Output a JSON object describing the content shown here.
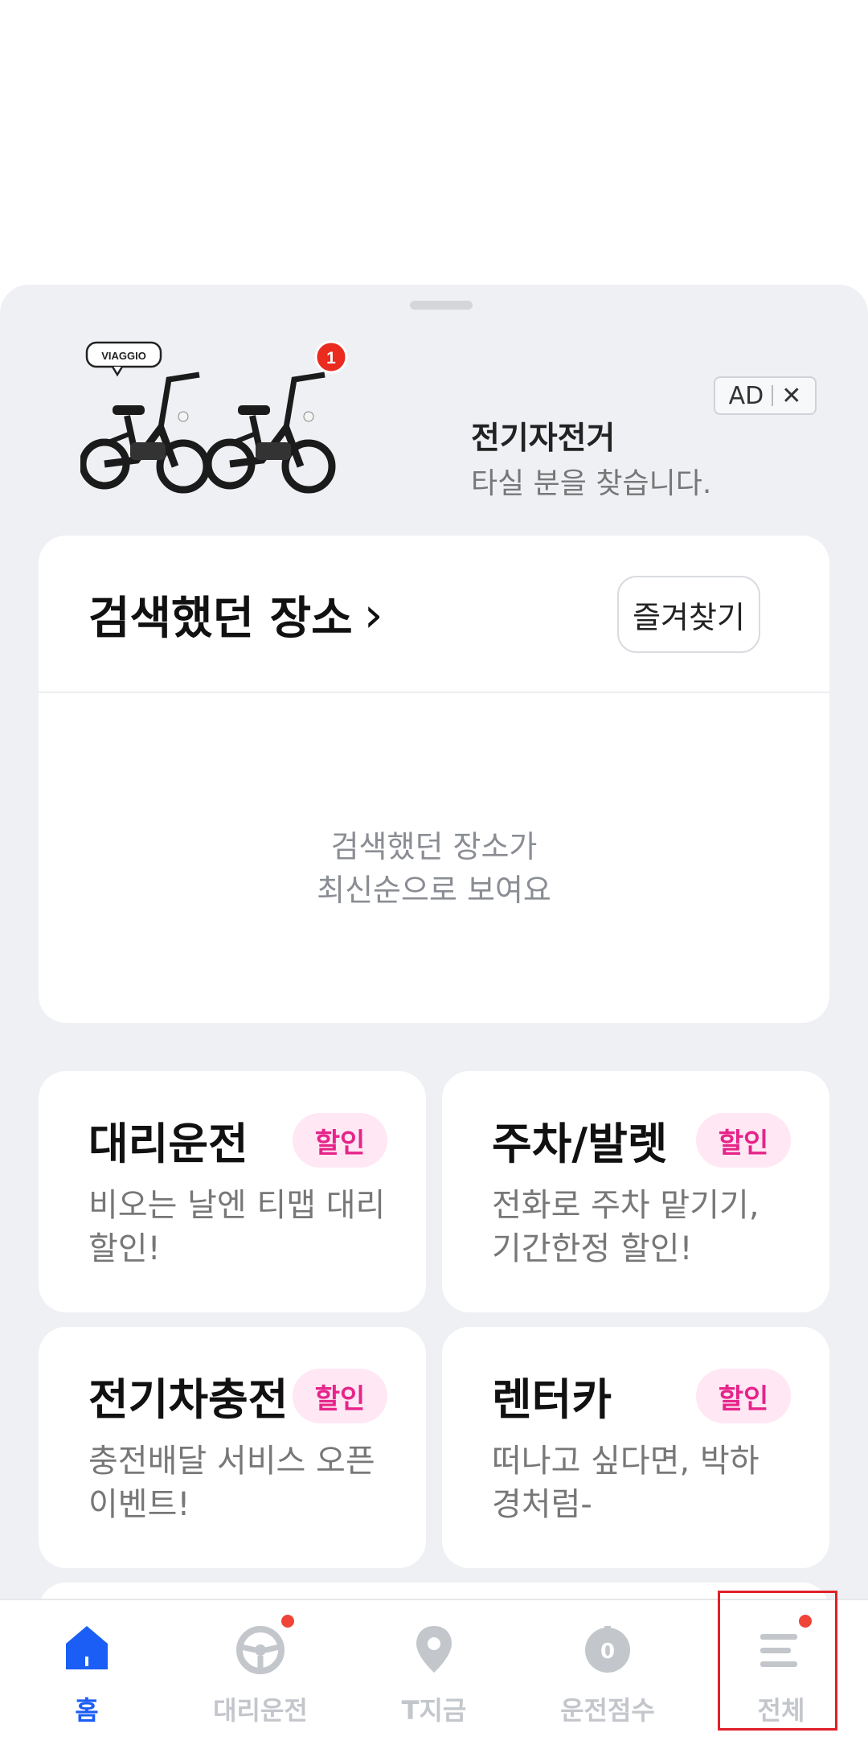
{
  "ad": {
    "brand": "VIAGGIO",
    "count_badge": "1",
    "title": "전기자전거",
    "subtitle": "타실 분을 찾습니다.",
    "tag": "AD",
    "close": "✕"
  },
  "recent": {
    "title": "검색했던 장소",
    "chevron": "›",
    "favorites_button": "즐겨찾기",
    "empty_line1": "검색했던 장소가",
    "empty_line2": "최신순으로 보여요"
  },
  "services": [
    {
      "title": "대리운전",
      "badge": "할인",
      "desc": "비오는 날엔 티맵 대리 할인!"
    },
    {
      "title": "주차/발렛",
      "badge": "할인",
      "desc": "전화로 주차 맡기기, 기간한정 할인!"
    },
    {
      "title": "전기차충전",
      "badge": "할인",
      "desc": "충전배달 서비스 오픈 이벤트!"
    },
    {
      "title": "렌터카",
      "badge": "할인",
      "desc": "떠나고 싶다면, 박하 경처럼-"
    }
  ],
  "nav": {
    "items": [
      {
        "label": "홈",
        "icon": "home-icon",
        "active": true
      },
      {
        "label": "대리운전",
        "icon": "steering-wheel-icon",
        "notification": true
      },
      {
        "label": "T지금",
        "icon": "location-pin-icon"
      },
      {
        "label": "운전점수",
        "icon": "speedometer-icon",
        "gauge_value": "0"
      },
      {
        "label": "전체",
        "icon": "menu-icon",
        "notification": true
      }
    ]
  },
  "colors": {
    "accent": "#1a5ef5",
    "badge_text": "#e6248a",
    "badge_bg": "#ffe7f3",
    "notification": "#f04438",
    "sheet_bg": "#eef0f4"
  }
}
